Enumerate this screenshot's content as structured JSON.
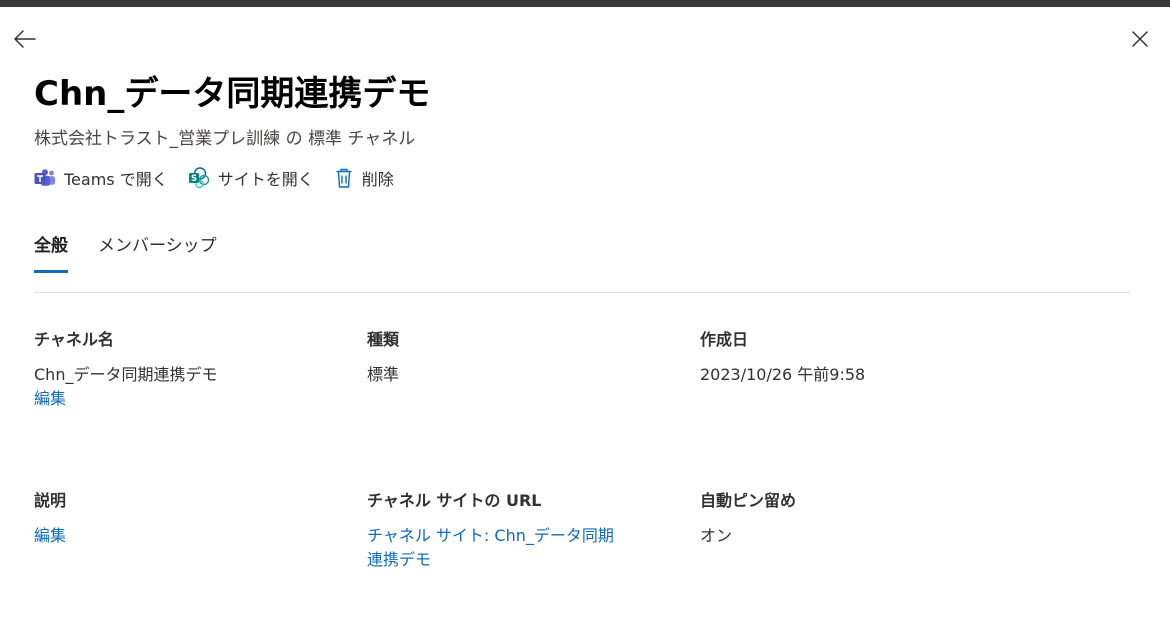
{
  "panel": {
    "title": "Chn_データ同期連携デモ",
    "subtitle": "株式会社トラスト_営業プレ訓練 の 標準 チャネル"
  },
  "actions": {
    "open_teams": "Teams で開く",
    "open_site": "サイトを開く",
    "delete": "削除"
  },
  "tabs": [
    {
      "label": "全般",
      "active": true
    },
    {
      "label": "メンバーシップ",
      "active": false
    }
  ],
  "fields": {
    "channel_name": {
      "label": "チャネル名",
      "value": "Chn_データ同期連携デモ",
      "edit_label": "編集"
    },
    "type": {
      "label": "種類",
      "value": "標準"
    },
    "created": {
      "label": "作成日",
      "value": "2023/10/26 午前9:58"
    },
    "description": {
      "label": "説明",
      "edit_label": "編集"
    },
    "site_url": {
      "label": "チャネル サイトの URL",
      "link_text": "チャネル サイト: Chn_データ同期連携デモ"
    },
    "auto_pin": {
      "label": "自動ピン留め",
      "value": "オン"
    }
  },
  "colors": {
    "accent": "#0f6cbd",
    "teams_purple": "#5b5fc7",
    "sharepoint_teal": "#038387"
  },
  "icons": {
    "back": "arrow-left-icon",
    "close": "close-icon",
    "teams": "teams-icon",
    "sharepoint": "sharepoint-icon",
    "delete": "trash-icon"
  }
}
